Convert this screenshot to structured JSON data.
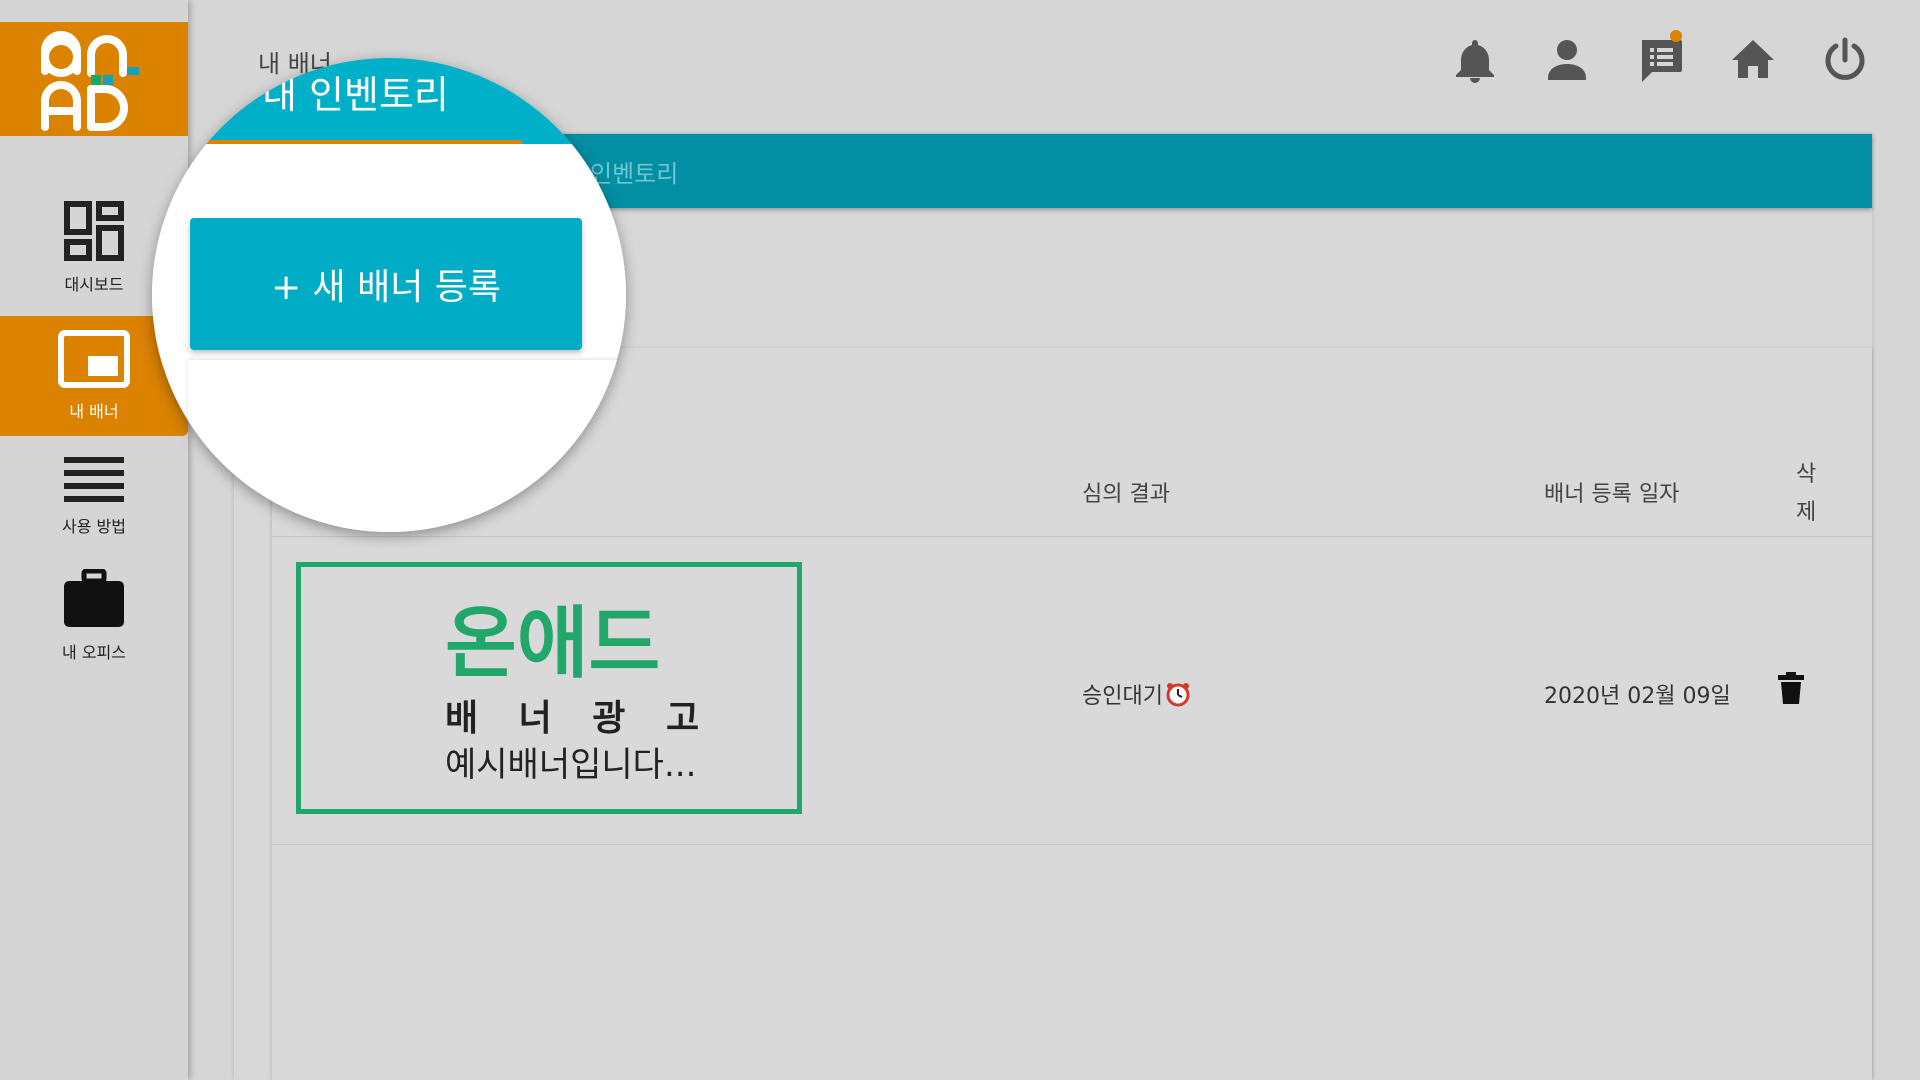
{
  "logo": {
    "top": "on",
    "bottom": "AD"
  },
  "sidebar": {
    "items": [
      {
        "label": "대시보드",
        "icon": "dashboard-icon",
        "active": false
      },
      {
        "label": "내 배너",
        "icon": "banner-icon",
        "active": true
      },
      {
        "label": "사용 방법",
        "icon": "menu-lines-icon",
        "active": false
      },
      {
        "label": "내 오피스",
        "icon": "briefcase-icon",
        "active": false
      }
    ]
  },
  "topbar": {
    "title": "내 배너",
    "icons": [
      "bell-icon",
      "user-icon",
      "chat-list-icon",
      "home-icon",
      "power-icon"
    ]
  },
  "tabs": {
    "inventory_label": "인벤토리"
  },
  "magnifier": {
    "tab_label": "내 인벤토리",
    "new_banner_button": "+ 새 배너 등록"
  },
  "table": {
    "headers": {
      "review": "심의 결과",
      "date": "배너 등록 일자",
      "delete": "삭제"
    },
    "rows": [
      {
        "banner": {
          "title": "온애드",
          "subtitle": "배 너 광 고",
          "desc": "예시배너입니다..."
        },
        "review_status": "승인대기",
        "date": "2020년 02월 09일"
      }
    ]
  },
  "colors": {
    "accent_orange": "#db8200",
    "teal": "#038fa3",
    "button_teal": "#00acc6",
    "banner_green": "#21a76a"
  }
}
